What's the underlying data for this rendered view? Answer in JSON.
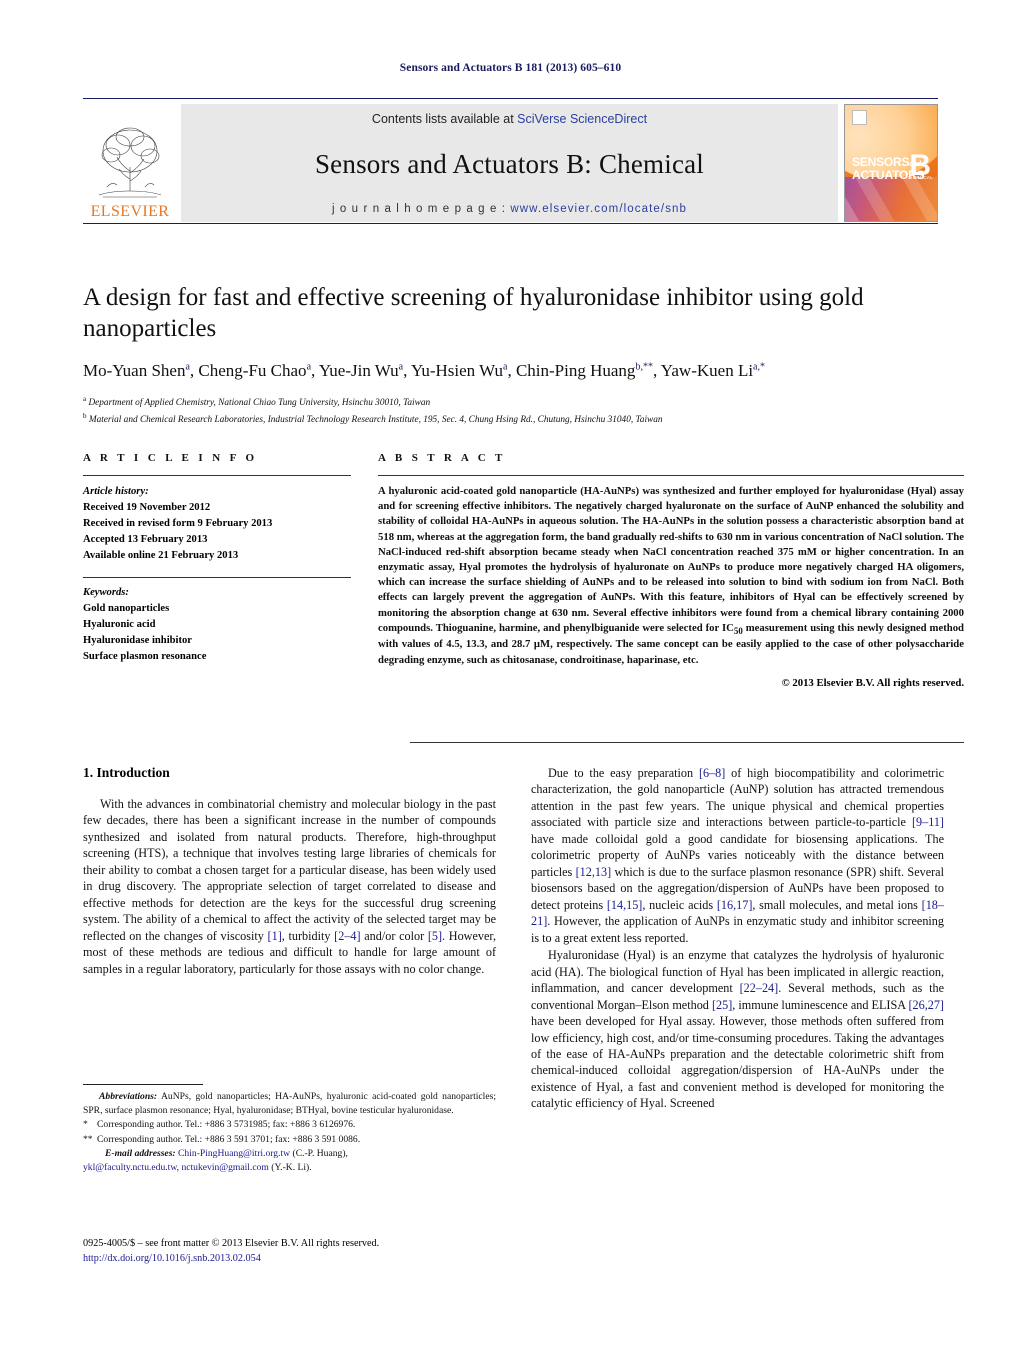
{
  "running_head": "Sensors and Actuators B 181 (2013) 605–610",
  "masthead": {
    "contents_prefix": "Contents lists available at ",
    "sciencedirect": "SciVerse ScienceDirect",
    "journal_title": "Sensors and Actuators B: Chemical",
    "homepage_label": "j o u r n a l   h o m e p a g e :  ",
    "homepage_url": "www.elsevier.com/locate/snb",
    "publisher": "ELSEVIER",
    "cover": {
      "line1": "SENSORS",
      "and": "and",
      "line2": "ACTUATORS",
      "volume_letter": "B",
      "subtitle": "CHEMICAL"
    },
    "colors": {
      "link_blue": "#2b3f9e",
      "elsevier_orange": "#E87722",
      "band_gray": "#e8e8e8",
      "rule_navy": "#1a1a5e"
    }
  },
  "title": "A design for fast and effective screening of hyaluronidase inhibitor using gold nanoparticles",
  "authors_html": "Mo-Yuan Shen<sup>a</sup>, Cheng-Fu Chao<sup>a</sup>, Yue-Jin Wu<sup>a</sup>, Yu-Hsien Wu<sup>a</sup>, Chin-Ping Huang<sup>b,**</sup>, Yaw-Kuen Li<sup>a,*</sup>",
  "affiliations": [
    {
      "marker": "a",
      "text": "Department of Applied Chemistry, National Chiao Tung University, Hsinchu 30010, Taiwan"
    },
    {
      "marker": "b",
      "text": "Material and Chemical Research Laboratories, Industrial Technology Research Institute, 195, Sec. 4, Chung Hsing Rd., Chutung, Hsinchu 31040, Taiwan"
    }
  ],
  "article_info": {
    "heading": "A R T I C L E   I N F O",
    "history_label": "Article history:",
    "history": [
      "Received 19 November 2012",
      "Received in revised form 9 February 2013",
      "Accepted 13 February 2013",
      "Available online 21 February 2013"
    ],
    "keywords_label": "Keywords:",
    "keywords": [
      "Gold nanoparticles",
      "Hyaluronic acid",
      "Hyaluronidase inhibitor",
      "Surface plasmon resonance"
    ]
  },
  "abstract": {
    "heading": "A B S T R A C T",
    "text": "A hyaluronic acid-coated gold nanoparticle (HA-AuNPs) was synthesized and further employed for hyaluronidase (Hyal) assay and for screening effective inhibitors. The negatively charged hyaluronate on the surface of AuNP enhanced the solubility and stability of colloidal HA-AuNPs in aqueous solution. The HA-AuNPs in the solution possess a characteristic absorption band at 518 nm, whereas at the aggregation form, the band gradually red-shifts to 630 nm in various concentration of NaCl solution. The NaCl-induced red-shift absorption became steady when NaCl concentration reached 375 mM or higher concentration. In an enzymatic assay, Hyal promotes the hydrolysis of hyaluronate on AuNPs to produce more negatively charged HA oligomers, which can increase the surface shielding of AuNPs and to be released into solution to bind with sodium ion from NaCl. Both effects can largely prevent the aggregation of AuNPs. With this feature, inhibitors of Hyal can be effectively screened by monitoring the absorption change at 630 nm. Several effective inhibitors were found from a chemical library containing 2000 compounds. Thioguanine, harmine, and phenylbiguanide were selected for IC50 measurement using this newly designed method with values of 4.5, 13.3, and 28.7 μM, respectively. The same concept can be easily applied to the case of other polysaccharide degrading enzyme, such as chitosanase, condroitinase, haparinase, etc.",
    "copyright": "© 2013 Elsevier B.V. All rights reserved."
  },
  "introduction": {
    "heading": "1.  Introduction",
    "left_paragraphs": [
      "With the advances in combinatorial chemistry and molecular biology in the past few decades, there has been a significant increase in the number of compounds synthesized and isolated from natural products. Therefore, high-throughput screening (HTS), a technique that involves testing large libraries of chemicals for their ability to combat a chosen target for a particular disease, has been widely used in drug discovery. The appropriate selection of target correlated to disease and effective methods for detection are the keys for the successful drug screening system. The ability of a chemical to affect the activity of the selected target may be reflected on the changes of viscosity [1], turbidity [2–4] and/or color [5]. However, most of these methods are tedious and difficult to handle for large amount of samples in a regular laboratory, particularly for those assays with no color change."
    ],
    "right_paragraphs": [
      "Due to the easy preparation [6–8] of high biocompatibility and colorimetric characterization, the gold nanoparticle (AuNP) solution has attracted tremendous attention in the past few years. The unique physical and chemical properties associated with particle size and interactions between particle-to-particle [9–11] have made colloidal gold a good candidate for biosensing applications. The colorimetric property of AuNPs varies noticeably with the distance between particles [12,13] which is due to the surface plasmon resonance (SPR) shift. Several biosensors based on the aggregation/dispersion of AuNPs have been proposed to detect proteins [14,15], nucleic acids [16,17], small molecules, and metal ions [18–21]. However, the application of AuNPs in enzymatic study and inhibitor screening is to a great extent less reported.",
      "Hyaluronidase (Hyal) is an enzyme that catalyzes the hydrolysis of hyaluronic acid (HA). The biological function of Hyal has been implicated in allergic reaction, inflammation, and cancer development [22–24]. Several methods, such as the conventional Morgan–Elson method [25], immune luminescence and ELISA [26,27] have been developed for Hyal assay. However, those methods often suffered from low efficiency, high cost, and/or time-consuming procedures. Taking the advantages of the ease of HA-AuNPs preparation and the detectable colorimetric shift from chemical-induced colloidal aggregation/dispersion of HA-AuNPs under the existence of Hyal, a fast and convenient method is developed for monitoring the catalytic efficiency of Hyal. Screened"
    ]
  },
  "footnotes": {
    "abbrev_label": "Abbreviations:",
    "abbrev_text": "AuNPs, gold nanoparticles; HA-AuNPs, hyaluronic acid-coated gold nanoparticles; SPR, surface plasmon resonance; Hyal, hyaluronidase; BTHyal, bovine testicular hyaluronidase.",
    "corresponding_1_marker": "*",
    "corresponding_1": "Corresponding author. Tel.: +886 3 5731985; fax: +886 3 6126976.",
    "corresponding_2_marker": "**",
    "corresponding_2": "Corresponding author. Tel.: +886 3 591 3701; fax: +886 3 591 0086.",
    "email_label": "E-mail addresses:",
    "email_1": "Chin-PingHuang@itri.org.tw",
    "email_1_owner": "(C.-P. Huang),",
    "email_2": "ykl@faculty.nctu.edu.tw",
    "email_3": "nctukevin@gmail.com",
    "email_3_owner": "(Y.-K. Li)."
  },
  "frontmatter": {
    "issn_line": "0925-4005/$ – see front matter © 2013 Elsevier B.V. All rights reserved.",
    "doi": "http://dx.doi.org/10.1016/j.snb.2013.02.054"
  }
}
